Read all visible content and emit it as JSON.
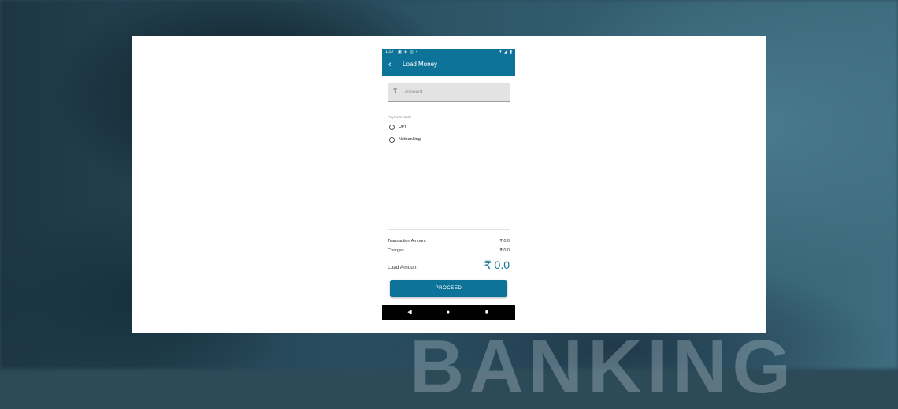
{
  "status_bar": {
    "time": "1:30",
    "left_icons": [
      "sim-icon",
      "shield-icon",
      "data-saver-icon",
      "sd-card-icon"
    ],
    "right_icons": [
      "wifi-icon",
      "signal-icon",
      "battery-icon"
    ]
  },
  "app_bar": {
    "back_icon": "back-arrow-icon",
    "title": "Load Money"
  },
  "amount_field": {
    "currency_symbol": "₹",
    "placeholder": "Amount",
    "value": ""
  },
  "payment_mode": {
    "label": "Payment Mode",
    "options": [
      {
        "label": "UPI",
        "selected": false
      },
      {
        "label": "Netbanking",
        "selected": false
      }
    ]
  },
  "summary": {
    "transaction_amount_label": "Transaction Amount",
    "transaction_amount_value": "₹ 0.0",
    "charges_label": "Charges",
    "charges_value": "₹ 0.0",
    "load_amount_label": "Load Amount",
    "load_amount_value": "₹ 0.0"
  },
  "proceed_label": "PROCEED",
  "nav_bar": {
    "back": "◀",
    "home": "●",
    "recents": "■"
  },
  "colors": {
    "primary": "#0e7398",
    "nav_bar": "#000000",
    "field_bg": "#e3e3e3"
  }
}
